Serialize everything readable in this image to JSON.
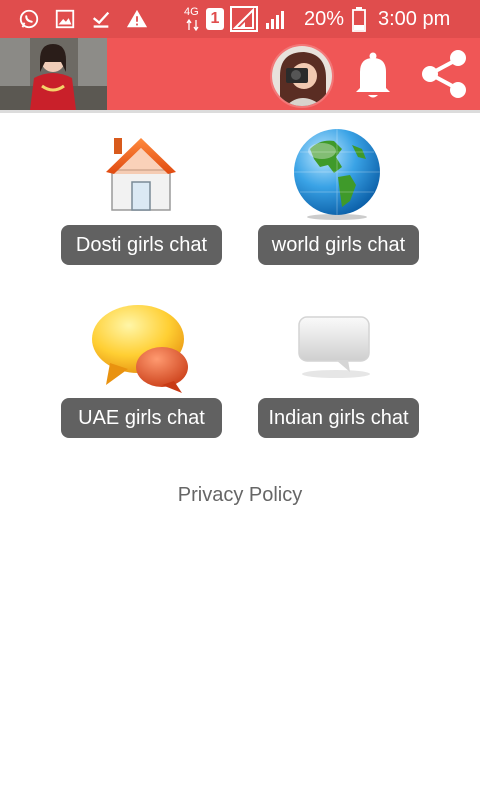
{
  "status_bar": {
    "network_type": "4G",
    "sim_slot": "1",
    "battery_percent": "20%",
    "time": "3:00 pm"
  },
  "menu": {
    "items": [
      {
        "label": "Dosti girls chat",
        "icon": "home-icon"
      },
      {
        "label": "world girls chat",
        "icon": "globe-icon"
      },
      {
        "label": "UAE girls chat",
        "icon": "chat-bubbles-icon"
      },
      {
        "label": "Indian girls chat",
        "icon": "speech-bubble-icon"
      }
    ]
  },
  "footer": {
    "privacy_label": "Privacy Policy"
  },
  "colors": {
    "status_bar": "#e04d4d",
    "app_bar": "#f05656",
    "button": "#616161"
  }
}
